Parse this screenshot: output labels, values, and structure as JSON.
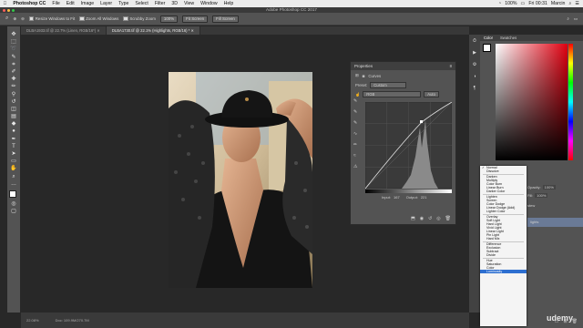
{
  "menubar": {
    "apple": "",
    "items": [
      "Photoshop CC",
      "File",
      "Edit",
      "Image",
      "Layer",
      "Type",
      "Select",
      "Filter",
      "3D",
      "View",
      "Window",
      "Help"
    ],
    "battery": "100%",
    "clock": "Fri 00:31",
    "user": "Marcin"
  },
  "window": {
    "title": "Adobe Photoshop CC 2017"
  },
  "options": {
    "resize_windows": "Resize Windows to Fit",
    "zoom_all": "Zoom All Windows",
    "scrubby": "Scrubby Zoom",
    "zoom_value": "100%",
    "fit_screen": "Fit Screen",
    "fill_screen": "Fill Screen"
  },
  "tabs": [
    {
      "label": "DLBA1933.tif @ 22.7% (Linen, RGB/16*)",
      "active": false
    },
    {
      "label": "DLBA1730.tif @ 22.1% (Highlights, RGB/16) *",
      "active": true
    }
  ],
  "status": {
    "zoom": "22.08%",
    "doc": "Doc: 109.9M/270.7M"
  },
  "properties": {
    "title": "Properties",
    "adjustment": "Curves",
    "preset_label": "Preset:",
    "preset_value": "Custom",
    "channel": "RGB",
    "auto": "Auto",
    "input_label": "Input:",
    "input_value": "167",
    "output_label": "Output:",
    "output_value": "221"
  },
  "right_panel": {
    "tab_color": "Color",
    "tab_swatches": "Swatches",
    "opacity_label": "Opacity:",
    "opacity_value": "100%",
    "fill_label": "Fill:",
    "fill_value": "100%",
    "layer_label": "lights",
    "layer_label2": "stew"
  },
  "blend_modes": [
    [
      "Normal",
      "Dissolve"
    ],
    [
      "Darken",
      "Multiply",
      "Color Burn",
      "Linear Burn",
      "Darker Color"
    ],
    [
      "Lighten",
      "Screen",
      "Color Dodge",
      "Linear Dodge (Add)",
      "Lighter Color"
    ],
    [
      "Overlay",
      "Soft Light",
      "Hard Light",
      "Vivid Light",
      "Linear Light",
      "Pin Light",
      "Hard Mix"
    ],
    [
      "Difference",
      "Exclusion",
      "Subtract",
      "Divide"
    ],
    [
      "Hue",
      "Saturation",
      "Color",
      "Luminosity"
    ]
  ],
  "blend_selected": "Luminosity",
  "blend_checked": "Normal",
  "watermark": "udemy",
  "colors": {
    "accent": "#2d6fd0",
    "panel": "#535353",
    "canvas": "#282828"
  }
}
